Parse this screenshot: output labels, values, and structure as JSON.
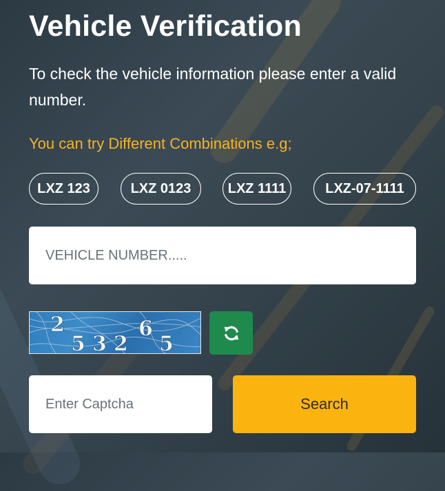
{
  "title": "Vehicle Verification",
  "description": "To check the vehicle information please enter a valid number.",
  "hint": "You can try Different Combinations e.g;",
  "examples": [
    "LXZ 123",
    "LXZ 0123",
    "LXZ 1111",
    "LXZ-07-1111"
  ],
  "vehicle_input": {
    "placeholder": "VEHICLE NUMBER.....",
    "value": ""
  },
  "captcha": {
    "code": "253265",
    "digits": [
      "2",
      "5",
      "3",
      "2",
      "6",
      "5"
    ]
  },
  "refresh_icon": "refresh-icon",
  "captcha_input": {
    "placeholder": "Enter Captcha",
    "value": ""
  },
  "search_button": "Search",
  "colors": {
    "accent": "#fbb40f",
    "hint": "#f7b322",
    "refresh": "#1e8a4c"
  }
}
